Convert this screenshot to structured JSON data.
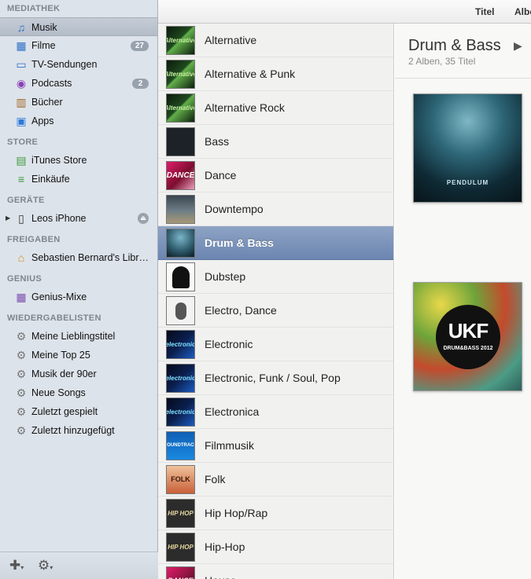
{
  "sidebar": {
    "sections": {
      "library": "MEDIATHEK",
      "store": "STORE",
      "devices": "GERÄTE",
      "shared": "FREIGABEN",
      "genius": "GENIUS",
      "playlists": "WIEDERGABELISTEN"
    },
    "library_items": [
      {
        "label": "Musik",
        "icon": "music-note-icon"
      },
      {
        "label": "Filme",
        "icon": "film-icon",
        "badge": "27"
      },
      {
        "label": "TV-Sendungen",
        "icon": "tv-icon"
      },
      {
        "label": "Podcasts",
        "icon": "podcast-icon",
        "badge": "2"
      },
      {
        "label": "Bücher",
        "icon": "book-icon"
      },
      {
        "label": "Apps",
        "icon": "app-store-icon"
      }
    ],
    "store_items": [
      {
        "label": "iTunes Store",
        "icon": "shopping-bag-icon"
      },
      {
        "label": "Einkäufe",
        "icon": "purchases-icon"
      }
    ],
    "device_items": [
      {
        "label": "Leos iPhone",
        "icon": "iphone-icon"
      }
    ],
    "shared_items": [
      {
        "label": "Sebastien Bernard's Libr…",
        "icon": "home-sharing-icon"
      }
    ],
    "genius_items": [
      {
        "label": "Genius-Mixe",
        "icon": "genius-mix-icon"
      }
    ],
    "playlist_items": [
      {
        "label": "Meine Lieblingstitel",
        "icon": "gear-icon"
      },
      {
        "label": "Meine Top 25",
        "icon": "gear-icon"
      },
      {
        "label": "Musik der 90er",
        "icon": "gear-icon"
      },
      {
        "label": "Neue Songs",
        "icon": "gear-icon"
      },
      {
        "label": "Zuletzt gespielt",
        "icon": "gear-icon"
      },
      {
        "label": "Zuletzt hinzugefügt",
        "icon": "gear-icon"
      }
    ],
    "selected": "Musik"
  },
  "header": {
    "tabs": [
      "Titel",
      "Albe"
    ]
  },
  "genres": [
    {
      "label": "Alternative",
      "thumb_text": "Alternative"
    },
    {
      "label": "Alternative & Punk",
      "thumb_text": "Alternative"
    },
    {
      "label": "Alternative Rock",
      "thumb_text": "Alternative"
    },
    {
      "label": "Bass",
      "thumb_text": ""
    },
    {
      "label": "Dance",
      "thumb_text": "DANCE"
    },
    {
      "label": "Downtempo",
      "thumb_text": ""
    },
    {
      "label": "Drum & Bass",
      "thumb_text": ""
    },
    {
      "label": "Dubstep",
      "thumb_text": ""
    },
    {
      "label": "Electro, Dance",
      "thumb_text": ""
    },
    {
      "label": "Electronic",
      "thumb_text": "electronic"
    },
    {
      "label": "Electronic, Funk / Soul, Pop",
      "thumb_text": "electronic"
    },
    {
      "label": "Electronica",
      "thumb_text": "electronic"
    },
    {
      "label": "Filmmusik",
      "thumb_text": "SOUNDTRACK"
    },
    {
      "label": "Folk",
      "thumb_text": "FOLK"
    },
    {
      "label": "Hip Hop/Rap",
      "thumb_text": "HIP HOP"
    },
    {
      "label": "Hip-Hop",
      "thumb_text": "HIP HOP"
    },
    {
      "label": "House",
      "thumb_text": "DANCE"
    }
  ],
  "selected_genre": "Drum & Bass",
  "detail": {
    "title": "Drum & Bass",
    "subtitle": "2 Alben, 35 Titel",
    "albums": [
      {
        "cover_text": "PENDULUM",
        "cover_style": "underwater"
      },
      {
        "cover_text": "UKF",
        "cover_subtext": "DRUM&BASS 2012",
        "cover_style": "colorful"
      }
    ]
  },
  "colors": {
    "sidebar_bg": "#dde3ea",
    "selection_blue": "#7b93bb",
    "badge": "#98a2ae"
  }
}
